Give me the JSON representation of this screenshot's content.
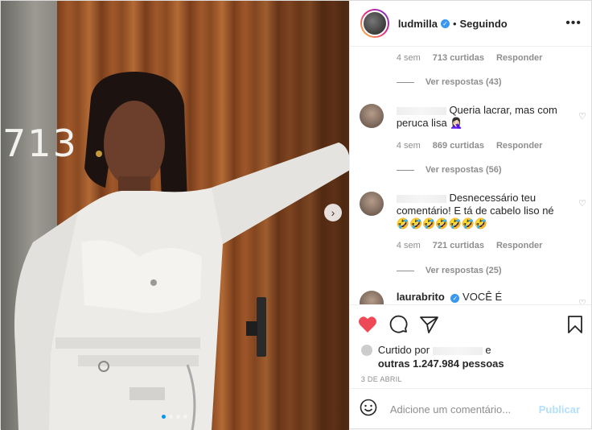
{
  "post": {
    "image": {
      "room_number": "713",
      "carousel_dots": 4,
      "active_dot": 0
    },
    "header": {
      "username": "ludmilla",
      "separator": "•",
      "follow_label": "Seguindo",
      "more_label": "•••"
    },
    "comments": [
      {
        "time": "4 sem",
        "likes": "713 curtidas",
        "reply_label": "Responder",
        "view_replies": "Ver respostas (43)"
      },
      {
        "user": "",
        "text": "Queria lacrar, mas com peruca lisa 🤦🏻‍♀️",
        "time": "4 sem",
        "likes": "869 curtidas",
        "reply_label": "Responder",
        "view_replies": "Ver respostas (56)"
      },
      {
        "user": "",
        "text": "Desnecessário teu comentário! E tá de cabelo liso né 🤣🤣🤣🤣🤣🤣🤣",
        "time": "4 sem",
        "likes": "721 curtidas",
        "reply_label": "Responder",
        "view_replies": "Ver respostas (25)"
      },
      {
        "user": "laurabrito",
        "text": "VOCÊ É"
      }
    ],
    "likes": {
      "prefix": "Curtido por",
      "suffix": "e",
      "others": "outras 1.247.984 pessoas"
    },
    "date": "3 DE ABRIL",
    "add_comment": {
      "placeholder": "Adicione um comentário...",
      "publish_label": "Publicar"
    },
    "colors": {
      "like_red": "#ed4956",
      "verified_blue": "#3897f0",
      "publish_disabled": "#b2dffc"
    },
    "icons": [
      "heart-icon",
      "comment-icon",
      "share-icon",
      "bookmark-icon",
      "emoji-icon",
      "verified-icon",
      "next-arrow-icon"
    ]
  }
}
